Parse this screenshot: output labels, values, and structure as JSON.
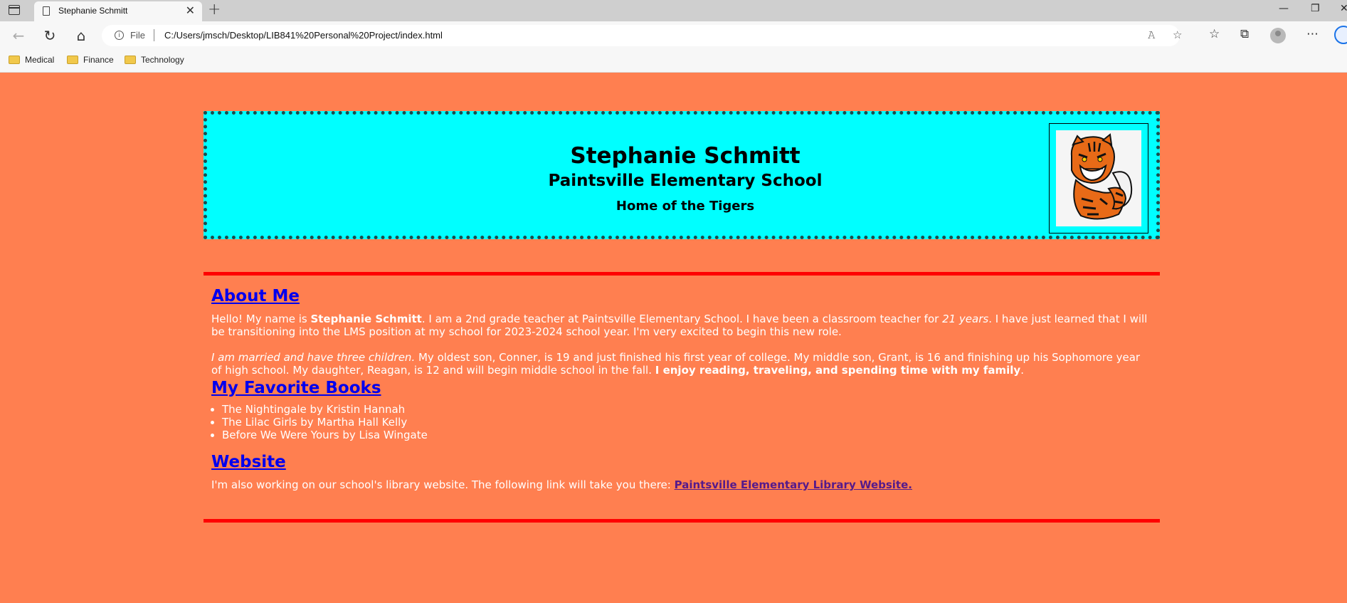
{
  "browser": {
    "tab_title": "Stephanie Schmitt",
    "file_label": "File",
    "url": "C:/Users/jmsch/Desktop/LIB841%20Personal%20Project/index.html",
    "bookmarks": [
      "Medical",
      "Finance",
      "Technology"
    ]
  },
  "header": {
    "name": "Stephanie Schmitt",
    "school": "Paintsville Elementary School",
    "tagline": "Home of the Tigers",
    "logo": "tiger-mascot-image"
  },
  "about": {
    "heading": "About Me",
    "p1_a": "Hello! My name is ",
    "p1_b": "Stephanie Schmitt",
    "p1_c": ". I am a 2nd grade teacher at Paintsville Elementary School. I have been a classroom teacher for ",
    "p1_d": "21 years",
    "p1_e": ". I have just learned that I will be transitioning into the LMS position at my school for 2023-2024 school year. I'm very excited to begin this new role.",
    "p2_a": "I am married and have three children.",
    "p2_b": " My oldest son, Conner, is 19 and just finished his first year of college. My middle son, Grant, is 16 and finishing up his Sophomore year of high school. My daughter, Reagan, is 12 and will begin middle school in the fall. ",
    "p2_c": "I enjoy reading, traveling, and spending time with my family",
    "p2_d": "."
  },
  "books": {
    "heading": "My Favorite Books",
    "items": [
      "The Nightingale by Kristin Hannah",
      "The Lilac Girls by Martha Hall Kelly",
      "Before We Were Yours by Lisa Wingate"
    ]
  },
  "website": {
    "heading": "Website",
    "text": "I'm also working on our school's library website. The following link will take you there: ",
    "link": "Paintsville Elementary Library Website."
  },
  "colors": {
    "page_bg": "#ff7f50",
    "header_bg": "#00ffff",
    "rule": "#ff0000",
    "heading_link": "#0000ee",
    "visited_link": "#551a8b"
  }
}
